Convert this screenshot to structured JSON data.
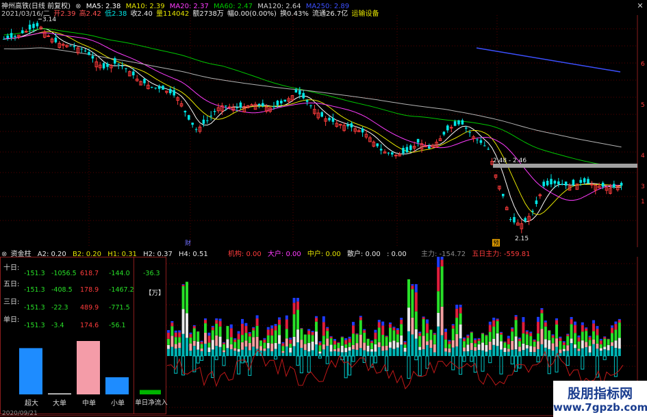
{
  "header": {
    "stock_name": "神州高铁(日线 前复权)",
    "ma5": "MA5: 2.38",
    "ma10": "MA10: 2.39",
    "ma20": "MA20: 2.37",
    "ma60": "MA60: 2.47",
    "ma120": "MA120: 2.64",
    "ma250": "MA250: 2.89",
    "date": "2021/03/16/二",
    "open": "开2.39",
    "high": "高2.42",
    "low": "低2.38",
    "close": "收2.40",
    "volume": "量114042",
    "amount": "额2738万",
    "change": "幅0.00(0.00%)",
    "turnover": "换0.43%",
    "float_cap": "流通26.7亿",
    "sector": "运输设备"
  },
  "main_chart": {
    "price_labels": [
      "3.14",
      "2.48 - 2.46",
      "2.15"
    ],
    "axis_ticks": [
      "6",
      "5",
      "4",
      "3",
      "1"
    ],
    "markers": [
      "财",
      "预"
    ],
    "colors": {
      "up": "#ff3c3c",
      "down": "#00e5e5",
      "ma5": "#ffffff",
      "ma10": "#e6e600",
      "ma20": "#ff3cff",
      "ma60": "#00c800",
      "ma120": "#b4b4b4",
      "ma250": "#3c50ff",
      "band": "#a0a0a0"
    }
  },
  "sub_header": {
    "name": "资金柱",
    "a2": "A2: 0.20",
    "b2": "B2: 0.20",
    "h1": "H1: 0.31",
    "h2": "H2: 0.37",
    "h4": "H4: 0.51",
    "jigou": "机构: 0.00",
    "dahu": "大户: 0.00",
    "zhonghu": "中户: 0.00",
    "sanhu": "散户: 0.00",
    "colon_val": ": 0.00",
    "zhuli": "主力: -154.72",
    "wuri_zhuli": "五日主力: -559.81"
  },
  "fund_panel": {
    "rows": [
      {
        "label": "十日:",
        "v1": "-151.3",
        "v2": "-1056.5",
        "v3": "618.7",
        "v4": "-144.0",
        "v5": "-36.3"
      },
      {
        "label": "五日:",
        "v1": "-151.3",
        "v2": "-408.5",
        "v3": "178.9",
        "v4": "-1467.2",
        "v5": ""
      },
      {
        "label": "三日:",
        "v1": "-151.3",
        "v2": "-22.3",
        "v3": "489.9",
        "v4": "-771.5",
        "v5": ""
      },
      {
        "label": "单日:",
        "v1": "-151.3",
        "v2": "-3.4",
        "v3": "174.6",
        "v4": "-56.1",
        "v5": ""
      }
    ],
    "unit": "【万】",
    "categories": [
      "超大",
      "大单",
      "中单",
      "小单"
    ],
    "net_label": "单日净流入",
    "bar_values": [
      -151.3,
      -3.4,
      174.6,
      -56.1
    ],
    "net_value": -36.3
  },
  "bottom": {
    "date_left": "2020/09/21"
  },
  "watermark": {
    "line1": "股朋指标网",
    "line2": "www.7gpzb.com"
  },
  "chart_data": [
    {
      "type": "candlestick",
      "title": "",
      "xlabel": "",
      "ylabel": "",
      "annotations": [
        "3.14",
        "2.48 - 2.46",
        "2.15"
      ],
      "series": [
        {
          "name": "MA5: 2.38"
        },
        {
          "name": "MA10: 2.39"
        },
        {
          "name": "MA20: 2.37"
        },
        {
          "name": "MA60: 2.47"
        },
        {
          "name": "MA120: 2.64"
        },
        {
          "name": "MA250: 2.89"
        }
      ]
    },
    {
      "type": "bar",
      "title": "",
      "categories": [
        "超大",
        "大单",
        "中单",
        "小单",
        "单日净流入"
      ],
      "values": [
        -151.3,
        -3.4,
        174.6,
        -56.1,
        -36.3
      ]
    }
  ]
}
